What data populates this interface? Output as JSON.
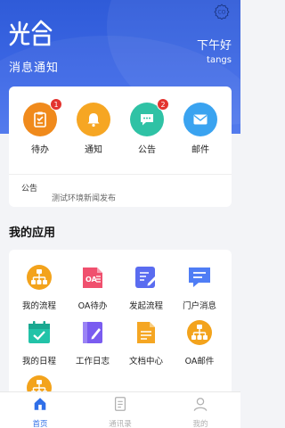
{
  "header": {
    "logo_text": "光合",
    "subtitle": "消息通知",
    "greeting": "下午好",
    "username": "tangs"
  },
  "quick_actions": [
    {
      "label": "待办",
      "badge": "1",
      "color": "#f08a1c",
      "icon": "clipboard-icon"
    },
    {
      "label": "通知",
      "badge": "",
      "color": "#f6a623",
      "icon": "bell-icon"
    },
    {
      "label": "公告",
      "badge": "2",
      "color": "#2fc2a5",
      "icon": "chat-icon"
    },
    {
      "label": "邮件",
      "badge": "",
      "color": "#3aa3f0",
      "icon": "mail-icon"
    }
  ],
  "notice": {
    "label": "公告",
    "text": "测试环境新闻发布"
  },
  "apps_section": {
    "title": "我的应用"
  },
  "apps": [
    {
      "label": "我的流程",
      "icon": "org-chart-icon",
      "color": "#f3a31c"
    },
    {
      "label": "OA待办",
      "icon": "oa-todo-icon",
      "color": "#f0506e"
    },
    {
      "label": "发起流程",
      "icon": "edit-doc-icon",
      "color": "#5a6cf0"
    },
    {
      "label": "门户消息",
      "icon": "message-icon",
      "color": "#4f7df5"
    },
    {
      "label": "我的日程",
      "icon": "calendar-icon",
      "color": "#22c3a8"
    },
    {
      "label": "工作日志",
      "icon": "journal-icon",
      "color": "#7a5cf0"
    },
    {
      "label": "文档中心",
      "icon": "document-icon",
      "color": "#f5a623"
    },
    {
      "label": "OA邮件",
      "icon": "oa-mail-icon",
      "color": "#f3a31c"
    },
    {
      "label": "",
      "icon": "org-chart-icon",
      "color": "#f3a31c"
    }
  ],
  "tabbar": [
    {
      "label": "首页",
      "icon": "home-icon",
      "active": true
    },
    {
      "label": "通讯录",
      "icon": "contacts-icon",
      "active": false
    },
    {
      "label": "我的",
      "icon": "profile-icon",
      "active": false
    }
  ]
}
